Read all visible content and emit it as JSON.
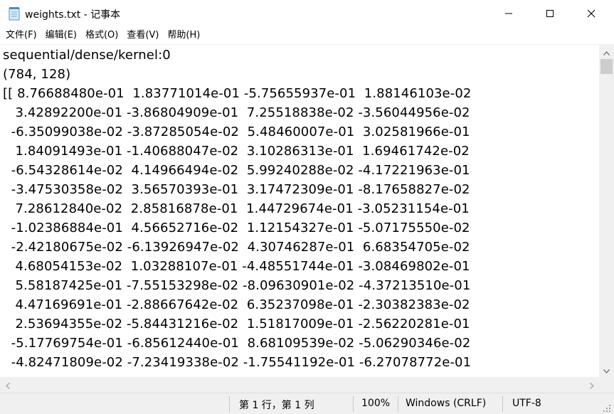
{
  "window": {
    "title": "weights.txt - 记事本"
  },
  "menu": {
    "items": [
      {
        "name": "menu-file",
        "label": "文件(F)"
      },
      {
        "name": "menu-edit",
        "label": "编辑(E)"
      },
      {
        "name": "menu-format",
        "label": "格式(O)"
      },
      {
        "name": "menu-view",
        "label": "查看(V)"
      },
      {
        "name": "menu-help",
        "label": "帮助(H)"
      }
    ]
  },
  "editor": {
    "lines": [
      "sequential/dense/kernel:0",
      "(784, 128)",
      "[[ 8.76688480e-01  1.83771014e-01 -5.75655937e-01  1.88146103e-02",
      "   3.42892200e-01 -3.86804909e-01  7.25518838e-02 -3.56044956e-02",
      "  -6.35099038e-02 -3.87285054e-02  5.48460007e-01  3.02581966e-01",
      "   1.84091493e-01 -1.40688047e-02  3.10286313e-01  1.69461742e-02",
      "  -6.54328614e-02  4.14966494e-02  5.99240288e-02 -4.17221963e-01",
      "  -3.47530358e-02  3.56570393e-01  3.17472309e-01 -8.17658827e-02",
      "   7.28612840e-02  2.85816878e-01  1.44729674e-01 -3.05231154e-01",
      "  -1.02386884e-01  4.56652716e-02  1.12154327e-01 -5.07175550e-02",
      "  -2.42180675e-02 -6.13926947e-02  4.30746287e-01  6.68354705e-02",
      "   4.68054153e-02  1.03288107e-01 -4.48551744e-01 -3.08469802e-01",
      "   5.58187425e-01 -7.55153298e-02 -8.09630901e-02 -4.37213510e-01",
      "   4.47169691e-01 -2.88667642e-02  6.35237098e-01 -2.30382383e-02",
      "   2.53694355e-02 -5.84431216e-02  1.51817009e-01 -2.56220281e-01",
      "  -5.17769754e-01 -6.85612440e-01  8.68109539e-02 -5.06290346e-02",
      "  -4.82471809e-02 -7.23419338e-02 -1.75541192e-01 -6.27078772e-01"
    ]
  },
  "statusbar": {
    "position": "第 1 行，第 1 列",
    "zoom": "100%",
    "line_ending": "Windows (CRLF)",
    "encoding": "UTF-8"
  },
  "colors": {
    "chrome_bg": "#f0f0f0",
    "scroll_thumb": "#cdcdcd"
  }
}
